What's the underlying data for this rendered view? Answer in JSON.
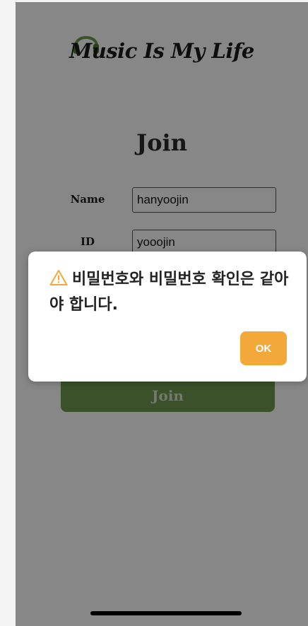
{
  "app": {
    "logo_text": "Music Is My Life",
    "page_title": "Join"
  },
  "form": {
    "name_label": "Name",
    "name_value": "hanyoojin",
    "id_label": "ID",
    "id_value": "yooojin",
    "submit_label": "Join"
  },
  "alert": {
    "message": "비밀번호와 비밀번호 확인은 같아야 합니다.",
    "ok_label": "OK"
  },
  "colors": {
    "accent_green": "#6e9a4e",
    "ok_orange": "#f3a93a",
    "warning_icon": "#f3a93a"
  },
  "icons": {
    "logo": "headphones-icon",
    "alert": "warning-triangle-icon"
  }
}
